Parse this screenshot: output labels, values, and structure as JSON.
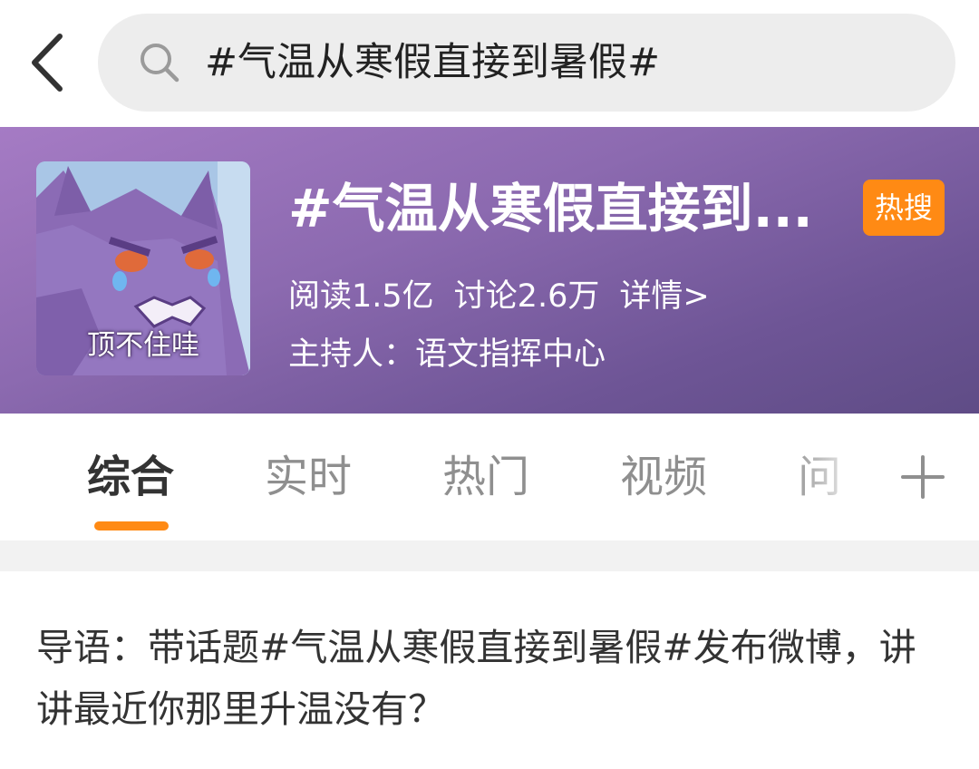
{
  "search": {
    "query": "#气温从寒假直接到暑假#"
  },
  "topic": {
    "title": "#气温从寒假直接到...",
    "badge": "热搜",
    "avatar_caption": "顶不住哇",
    "stats": {
      "reads": "阅读1.5亿",
      "discussions": "讨论2.6万",
      "details_link": "详情>"
    },
    "host": "主持人：语文指挥中心",
    "colors": {
      "banner_top": "#a57bc4",
      "banner_bottom": "#5f4c86",
      "badge": "#ff8a14"
    }
  },
  "tabs": {
    "items": [
      {
        "label": "综合",
        "active": true
      },
      {
        "label": "实时",
        "active": false
      },
      {
        "label": "热门",
        "active": false
      },
      {
        "label": "视频",
        "active": false
      },
      {
        "label": "问",
        "active": false
      }
    ],
    "accent": "#ff8a14",
    "more_icon": "plus-icon"
  },
  "lead": {
    "text": "导语：带话题#气温从寒假直接到暑假#发布微博，讲讲最近你那里升温没有？"
  },
  "icons": {
    "back": "chevron-left-icon",
    "search": "search-icon"
  }
}
